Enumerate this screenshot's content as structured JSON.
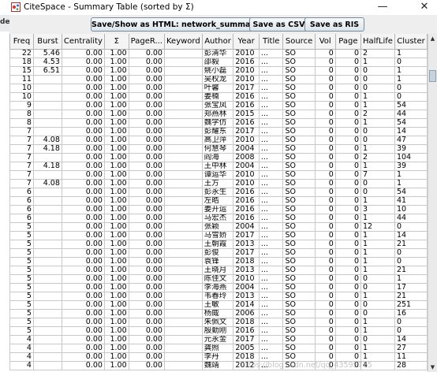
{
  "background_left": {
    "line1": "0",
    "line2": "de"
  },
  "window": {
    "title": "CiteSpace - Summary Table (sorted by Σ)",
    "minimize": "—",
    "close": "✕"
  },
  "toolbar": {
    "html_label": "Save/Show as HTML: network_summary.html",
    "csv_label": "Save as CSV",
    "ris_label": "Save as RIS"
  },
  "table": {
    "columns": [
      "Freq",
      "Burst",
      "Centrality",
      "Σ",
      "PageR...",
      "Keyword",
      "Author",
      "Year",
      "Title",
      "Source",
      "Vol",
      "Page",
      "HalfLife",
      "Cluster"
    ],
    "rows": [
      [
        "22",
        "5.46",
        "0.00",
        "1.00",
        "0.00",
        "",
        "彭清华",
        "2010",
        "...",
        "SO",
        "0",
        "0",
        "2",
        "1"
      ],
      [
        "18",
        "4.53",
        "0.00",
        "1.00",
        "0.00",
        "",
        "邵毅",
        "2016",
        "...",
        "SO",
        "0",
        "0",
        "1",
        "0"
      ],
      [
        "15",
        "6.51",
        "0.00",
        "1.00",
        "0.00",
        "",
        "姚小磊",
        "2010",
        "...",
        "SO",
        "0",
        "0",
        "0",
        "1"
      ],
      [
        "11",
        "",
        "0.00",
        "1.00",
        "0.00",
        "",
        "吴权龙",
        "2010",
        "...",
        "SO",
        "0",
        "0",
        "0",
        "1"
      ],
      [
        "10",
        "",
        "0.00",
        "1.00",
        "0.00",
        "",
        "叶馨",
        "2017",
        "...",
        "SO",
        "0",
        "0",
        "0",
        "0"
      ],
      [
        "10",
        "",
        "0.00",
        "1.00",
        "0.00",
        "",
        "姜楠",
        "2016",
        "...",
        "SO",
        "0",
        "0",
        "1",
        "0"
      ],
      [
        "9",
        "",
        "0.00",
        "1.00",
        "0.00",
        "",
        "张宝凤",
        "2016",
        "...",
        "SO",
        "0",
        "0",
        "1",
        "54"
      ],
      [
        "8",
        "",
        "0.00",
        "1.00",
        "0.00",
        "",
        "郑燕林",
        "2015",
        "...",
        "SO",
        "0",
        "0",
        "2",
        "44"
      ],
      [
        "8",
        "",
        "0.00",
        "1.00",
        "0.00",
        "",
        "魏学仿",
        "2016",
        "...",
        "SO",
        "0",
        "0",
        "1",
        "54"
      ],
      [
        "7",
        "",
        "0.00",
        "1.00",
        "0.00",
        "",
        "彭耀东",
        "2017",
        "...",
        "SO",
        "0",
        "0",
        "0",
        "14"
      ],
      [
        "7",
        "4.08",
        "0.00",
        "1.00",
        "0.00",
        "",
        "高卫萍",
        "2010",
        "...",
        "SO",
        "0",
        "0",
        "0",
        "47"
      ],
      [
        "7",
        "4.18",
        "0.00",
        "1.00",
        "0.00",
        "",
        "何慧琴",
        "2004",
        "...",
        "SO",
        "0",
        "0",
        "1",
        "39"
      ],
      [
        "7",
        "",
        "0.00",
        "1.00",
        "0.00",
        "",
        "阎海",
        "2008",
        "...",
        "SO",
        "0",
        "0",
        "2",
        "104"
      ],
      [
        "7",
        "4.18",
        "0.00",
        "1.00",
        "0.00",
        "",
        "王中林",
        "2004",
        "...",
        "SO",
        "0",
        "0",
        "1",
        "39"
      ],
      [
        "7",
        "",
        "0.00",
        "1.00",
        "0.00",
        "",
        "谭运华",
        "2010",
        "...",
        "SO",
        "0",
        "0",
        "7",
        "1"
      ],
      [
        "7",
        "4.08",
        "0.00",
        "1.00",
        "0.00",
        "",
        "王方",
        "2010",
        "...",
        "SO",
        "0",
        "0",
        "0",
        "1"
      ],
      [
        "6",
        "",
        "0.00",
        "1.00",
        "0.00",
        "",
        "彭永生",
        "2016",
        "...",
        "SO",
        "0",
        "0",
        "0",
        "54"
      ],
      [
        "6",
        "",
        "0.00",
        "1.00",
        "0.00",
        "",
        "左皓",
        "2016",
        "...",
        "SO",
        "0",
        "0",
        "1",
        "41"
      ],
      [
        "6",
        "",
        "0.00",
        "1.00",
        "0.00",
        "",
        "姜开运",
        "2016",
        "...",
        "SO",
        "0",
        "0",
        "3",
        "10"
      ],
      [
        "6",
        "",
        "0.00",
        "1.00",
        "0.00",
        "",
        "马宏杰",
        "2016",
        "...",
        "SO",
        "0",
        "0",
        "1",
        "44"
      ],
      [
        "5",
        "",
        "0.00",
        "1.00",
        "0.00",
        "",
        "张颖",
        "2004",
        "...",
        "SO",
        "0",
        "0",
        "12",
        "0"
      ],
      [
        "5",
        "",
        "0.00",
        "1.00",
        "0.00",
        "",
        "马雪娇",
        "2017",
        "...",
        "SO",
        "0",
        "0",
        "1",
        "14"
      ],
      [
        "5",
        "",
        "0.00",
        "1.00",
        "0.00",
        "",
        "王朝霞",
        "2013",
        "...",
        "SO",
        "0",
        "0",
        "1",
        "21"
      ],
      [
        "5",
        "",
        "0.00",
        "1.00",
        "0.00",
        "",
        "彭俊",
        "2017",
        "...",
        "SO",
        "0",
        "0",
        "1",
        "0"
      ],
      [
        "5",
        "",
        "0.00",
        "1.00",
        "0.00",
        "",
        "袁锋",
        "2018",
        "...",
        "SO",
        "0",
        "0",
        "1",
        "0"
      ],
      [
        "5",
        "",
        "0.00",
        "1.00",
        "0.00",
        "",
        "王晓月",
        "2013",
        "...",
        "SO",
        "0",
        "0",
        "1",
        "21"
      ],
      [
        "5",
        "",
        "0.00",
        "1.00",
        "0.00",
        "",
        "陈佳文",
        "2010",
        "...",
        "SO",
        "0",
        "0",
        "0",
        "1"
      ],
      [
        "5",
        "",
        "0.00",
        "1.00",
        "0.00",
        "",
        "李海燕",
        "2004",
        "...",
        "SO",
        "0",
        "0",
        "0",
        "17"
      ],
      [
        "5",
        "",
        "0.00",
        "1.00",
        "0.00",
        "",
        "韦春玲",
        "2013",
        "...",
        "SO",
        "0",
        "0",
        "1",
        "21"
      ],
      [
        "5",
        "",
        "0.00",
        "1.00",
        "0.00",
        "",
        "王敏",
        "2014",
        "...",
        "SO",
        "0",
        "0",
        "0",
        "251"
      ],
      [
        "5",
        "",
        "0.00",
        "1.00",
        "0.00",
        "",
        "杨威",
        "2006",
        "...",
        "SO",
        "0",
        "0",
        "0",
        "16"
      ],
      [
        "5",
        "",
        "0.00",
        "1.00",
        "0.00",
        "",
        "朱佩文",
        "2018",
        "...",
        "SO",
        "0",
        "0",
        "1",
        "0"
      ],
      [
        "5",
        "",
        "0.00",
        "1.00",
        "0.00",
        "",
        "殷勤刚",
        "2016",
        "...",
        "SO",
        "0",
        "0",
        "1",
        "0"
      ],
      [
        "4",
        "",
        "0.00",
        "1.00",
        "0.00",
        "",
        "元永金",
        "2017",
        "...",
        "SO",
        "0",
        "0",
        "0",
        "14"
      ],
      [
        "4",
        "",
        "0.00",
        "1.00",
        "0.00",
        "",
        "龚照",
        "2005",
        "...",
        "SO",
        "0",
        "0",
        "1",
        "27"
      ],
      [
        "4",
        "",
        "0.00",
        "1.00",
        "0.00",
        "",
        "李丹",
        "2018",
        "...",
        "SO",
        "0",
        "0",
        "1",
        "11"
      ],
      [
        "4",
        "",
        "0.00",
        "1.00",
        "0.00",
        "",
        "魏靖",
        "2012",
        "...",
        "SO",
        "0",
        "0",
        "4",
        "28"
      ]
    ]
  },
  "scrollbar": {
    "up": "▲",
    "down": "▼"
  },
  "watermark": "https://blog.csdn.net/qq_43595775",
  "colors": {
    "toolbar": "#eeeeee",
    "header": "#f4f4f4",
    "grid": "#c8c8c8"
  }
}
